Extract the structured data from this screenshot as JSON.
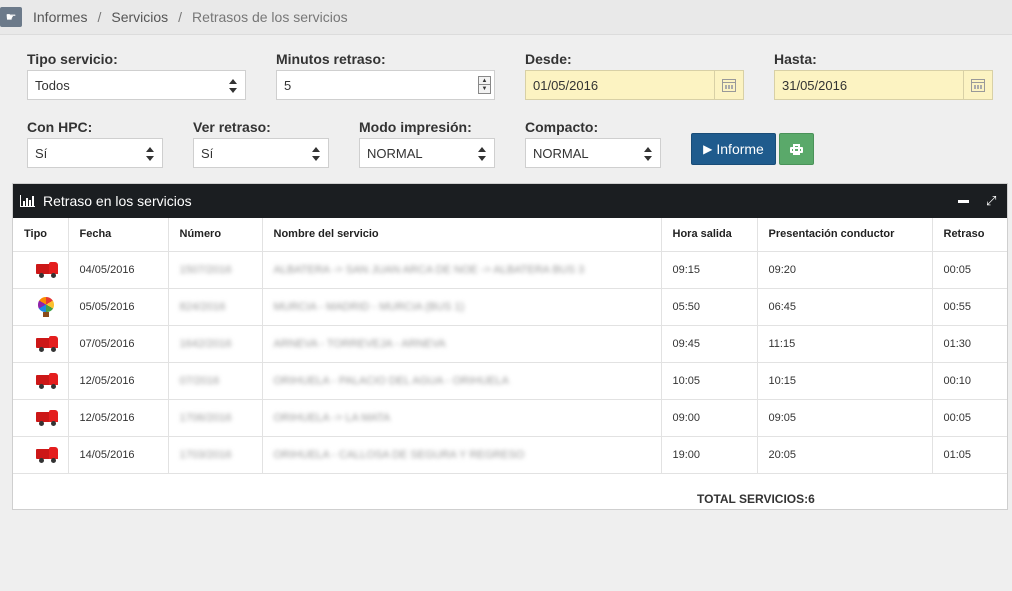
{
  "breadcrumb": [
    "Informes",
    "Servicios",
    "Retrasos de los servicios"
  ],
  "breadcrumb_separator": "/",
  "filters": {
    "tipo_servicio": {
      "label": "Tipo servicio:",
      "value": "Todos"
    },
    "minutos_retraso": {
      "label": "Minutos retraso:",
      "value": "5"
    },
    "desde": {
      "label": "Desde:",
      "value": "01/05/2016"
    },
    "hasta": {
      "label": "Hasta:",
      "value": "31/05/2016"
    },
    "con_hpc": {
      "label": "Con HPC:",
      "value": "Sí"
    },
    "ver_retraso": {
      "label": "Ver retraso:",
      "value": "Sí"
    },
    "modo_impresion": {
      "label": "Modo impresión:",
      "value": "NORMAL"
    },
    "compacto": {
      "label": "Compacto:",
      "value": "NORMAL"
    }
  },
  "buttons": {
    "informe": "Informe",
    "print_icon": "printer-icon"
  },
  "panel": {
    "title": "Retraso en los servicios",
    "icon": "bar-chart-icon"
  },
  "table": {
    "columns": [
      "Tipo",
      "Fecha",
      "Número",
      "Nombre del servicio",
      "Hora salida",
      "Presentación conductor",
      "Retraso"
    ],
    "rows": [
      {
        "tipo": "truck",
        "fecha": "04/05/2016",
        "numero": "1507/2016",
        "nombre": "ALBATERA -> SAN JUAN ARCA DE NOE -> ALBATERA BUS 3",
        "salida": "09:15",
        "presentacion": "09:20",
        "retraso": "00:05"
      },
      {
        "tipo": "balloon",
        "fecha": "05/05/2016",
        "numero": "824/2016",
        "nombre": "MURCIA - MADRID - MURCIA (BUS 1)",
        "salida": "05:50",
        "presentacion": "06:45",
        "retraso": "00:55"
      },
      {
        "tipo": "truck",
        "fecha": "07/05/2016",
        "numero": "1642/2016",
        "nombre": "ARNEVA - TORREVEJA - ARNEVA",
        "salida": "09:45",
        "presentacion": "11:15",
        "retraso": "01:30"
      },
      {
        "tipo": "truck",
        "fecha": "12/05/2016",
        "numero": "07/2016",
        "nombre": "ORIHUELA - PALACIO DEL AGUA - ORIHUELA",
        "salida": "10:05",
        "presentacion": "10:15",
        "retraso": "00:10"
      },
      {
        "tipo": "truck",
        "fecha": "12/05/2016",
        "numero": "1706/2016",
        "nombre": "ORIHUELA -> LA MATA",
        "salida": "09:00",
        "presentacion": "09:05",
        "retraso": "00:05"
      },
      {
        "tipo": "truck",
        "fecha": "14/05/2016",
        "numero": "1703/2016",
        "nombre": "ORIHUELA - CALLOSA DE SEGURA Y REGRESO",
        "salida": "19:00",
        "presentacion": "20:05",
        "retraso": "01:05"
      }
    ]
  },
  "total": "TOTAL SERVICIOS:6",
  "colors": {
    "primary_button": "#1f5b8d",
    "print_button": "#5aa96a",
    "panel_header": "#1b1e21",
    "date_bg": "#fcf3c2"
  }
}
